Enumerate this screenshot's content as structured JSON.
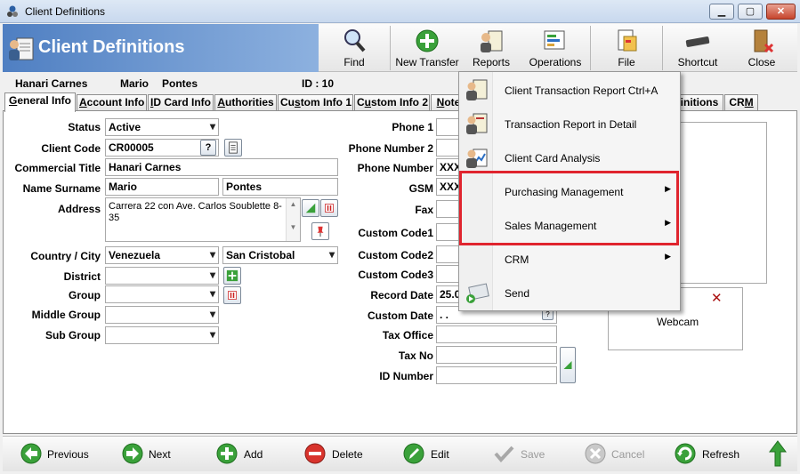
{
  "window": {
    "title": "Client Definitions"
  },
  "header": {
    "title": "Client Definitions"
  },
  "toolbar": {
    "find": "Find",
    "new_transfer": "New Transfer",
    "reports": "Reports",
    "operations": "Operations",
    "file": "File",
    "shortcut": "Shortcut",
    "close": "Close"
  },
  "client": {
    "company": "Hanari Carnes",
    "first_name": "Mario",
    "last_name": "Pontes",
    "id_label": "ID : 10"
  },
  "tabs": [
    {
      "pre": "",
      "u": "G",
      "post": "eneral Info"
    },
    {
      "pre": "",
      "u": "A",
      "post": "ccount Info"
    },
    {
      "pre": "",
      "u": "I",
      "post": "D Card Info"
    },
    {
      "pre": "",
      "u": "A",
      "post": "uthorities"
    },
    {
      "pre": "Cu",
      "u": "s",
      "post": "tom Info 1"
    },
    {
      "pre": "C",
      "u": "u",
      "post": "stom Info 2"
    },
    {
      "pre": "",
      "u": "N",
      "post": "ote"
    },
    {
      "pre": "",
      "u": "",
      "post": "finitions"
    },
    {
      "pre": "CR",
      "u": "M",
      "post": ""
    }
  ],
  "form_left": {
    "status_label": "Status",
    "status_value": "Active",
    "client_code_label": "Client Code",
    "client_code_value": "CR00005",
    "commercial_title_label": "Commercial Title",
    "commercial_title_value": "Hanari Carnes",
    "name_surname_label": "Name Surname",
    "name_value": "Mario",
    "surname_value": "Pontes",
    "address_label": "Address",
    "address_value": "Carrera 22 con Ave. Carlos Soublette 8-35",
    "country_city_label": "Country / City",
    "country_value": "Venezuela",
    "city_value": "San Cristobal",
    "district_label": "District",
    "group_label": "Group",
    "middle_group_label": "Middle Group",
    "sub_group_label": "Sub Group",
    "help_glyph": "?"
  },
  "form_right": {
    "phone1_label": "Phone 1",
    "phone2_label": "Phone Number 2",
    "phone_number_label": "Phone Number",
    "phone_number_value": "XXX",
    "gsm_label": "GSM",
    "gsm_value": "XXX",
    "fax_label": "Fax",
    "custom_code1_label": "Custom Code1",
    "custom_code2_label": "Custom Code2",
    "custom_code3_label": "Custom Code3",
    "record_date_label": "Record Date",
    "record_date_value": "25.0",
    "custom_date_label": "Custom Date",
    "custom_date_value": ". .",
    "tax_office_label": "Tax Office",
    "tax_no_label": "Tax No",
    "id_number_label": "ID Number"
  },
  "webcam": {
    "label": "Webcam",
    "close_glyph": "✕"
  },
  "bottom": {
    "previous": "Previous",
    "next": "Next",
    "add": "Add",
    "delete": "Delete",
    "edit": "Edit",
    "save": "Save",
    "cancel": "Cancel",
    "refresh": "Refresh"
  },
  "menu": {
    "items": [
      {
        "label": "Client Transaction Report Ctrl+A"
      },
      {
        "label": "Transaction Report in Detail"
      },
      {
        "label": "Client Card Analysis"
      },
      {
        "label": "Purchasing Management",
        "submenu": true
      },
      {
        "label": "Sales Management",
        "submenu": true
      },
      {
        "label": "CRM",
        "submenu": true
      },
      {
        "label": "Send"
      }
    ],
    "arrow": "▶"
  },
  "colors": {
    "header_blue": "#4f7fc2",
    "highlight_red": "#e0242e",
    "green_icon": "#3aa13a"
  }
}
